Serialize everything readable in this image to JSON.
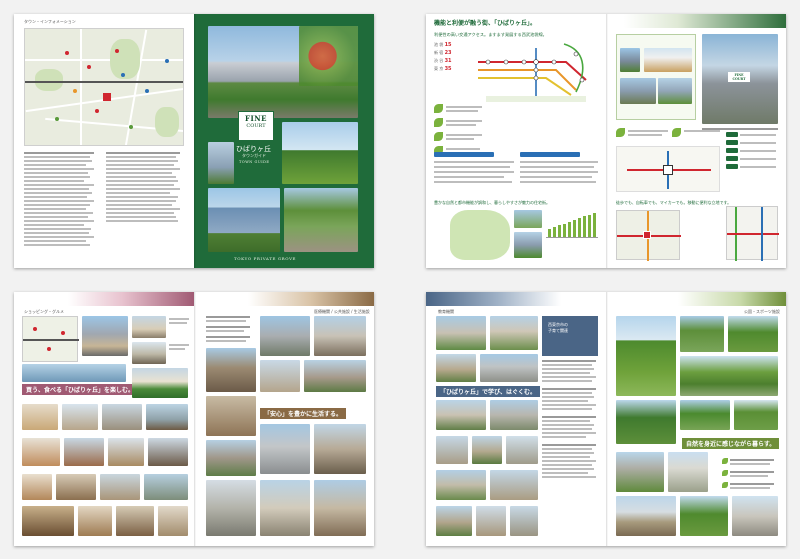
{
  "spread1": {
    "map_section_label": "タウン・インフォメーション",
    "brand_line1": "FINE",
    "brand_line2": "COURT",
    "brand_place": "ひばりヶ丘",
    "brand_sub": "タウンガイド",
    "town_guide": "TOWN GUIDE",
    "footer": "TOKYO PRIVATE GROVE",
    "map_legend": [
      "1",
      "2",
      "3",
      "4",
      "5",
      "6",
      "7",
      "8"
    ]
  },
  "spread2": {
    "title": "機能と利便が融う街、「ひばりヶ丘」。",
    "access_heading": "利便性の高い交通アクセス。ますます発展する西武池袋線。",
    "stations": [
      {
        "name": "池 袋",
        "min": "15"
      },
      {
        "name": "新 宿",
        "min": "23"
      },
      {
        "name": "渋 谷",
        "min": "31"
      },
      {
        "name": "東 京",
        "min": "35"
      }
    ],
    "nature_heading": "豊かな自然と都市機能が調和し、暮らしやすさが魅力の住宅街。",
    "car_heading": "徒歩でも、自転車でも、マイカーでも。移動に便利な立地です。",
    "tower_label": "FINE COURT"
  },
  "spread3": {
    "section_label": "ショッピング・グルメ",
    "section_label_right": "医療機関 / 公共施設 / 生活施設",
    "catch_left": "買う、食べる「ひばりヶ丘」を楽しむ。",
    "catch_right": "「安心」を豊かに生活する。"
  },
  "spread4": {
    "section_label": "教育機関",
    "section_label_right": "公園・スポーツ施設",
    "edu_title": "西東京市の\n子育て関連",
    "catch_left": "「ひばりヶ丘」で学び、はぐくむ。",
    "catch_right": "自然を身近に感じながら暮らす。"
  },
  "colors": {
    "green": "#1f6b3a",
    "dark_green": "#0f4d28",
    "olive": "#6f8f3a",
    "mauve": "#a05a73",
    "tan": "#8a6a45",
    "slate": "#4a6586",
    "rail_red": "#d0262f",
    "rail_orange": "#e8962a",
    "rail_yellow": "#e3c12f"
  }
}
